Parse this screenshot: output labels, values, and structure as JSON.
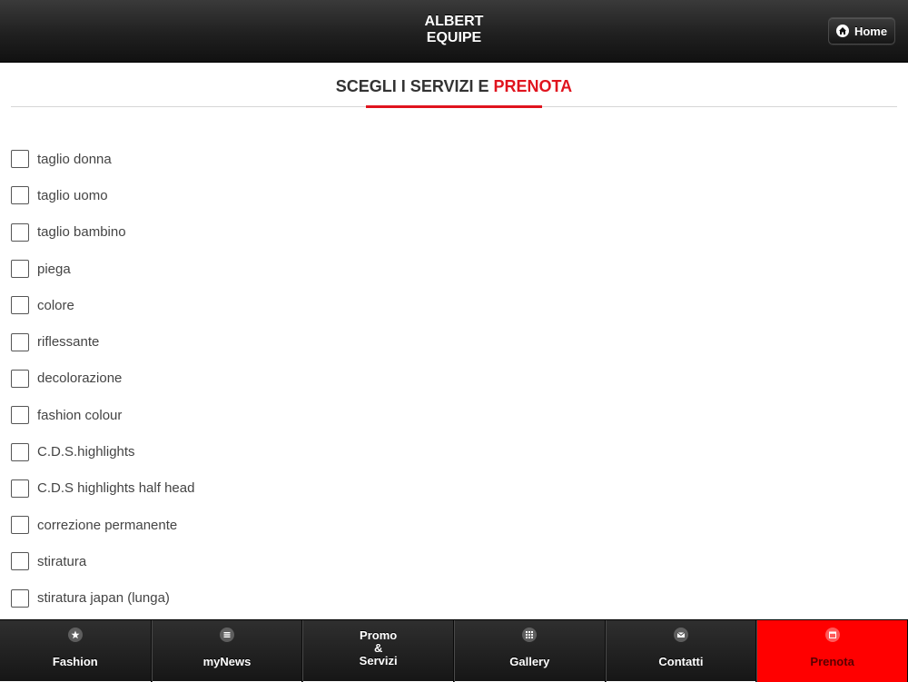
{
  "header": {
    "title_line1": "ALBERT",
    "title_line2": "EQUIPE",
    "home_label": "Home"
  },
  "section": {
    "title_main": "SCEGLI I SERVIZI E ",
    "title_accent": "PRENOTA"
  },
  "services": [
    {
      "label": "taglio donna",
      "checked": false
    },
    {
      "label": "taglio uomo",
      "checked": false
    },
    {
      "label": "taglio bambino",
      "checked": false
    },
    {
      "label": "piega",
      "checked": false
    },
    {
      "label": "colore",
      "checked": false
    },
    {
      "label": "riflessante",
      "checked": false
    },
    {
      "label": "decolorazione",
      "checked": false
    },
    {
      "label": "fashion colour",
      "checked": false
    },
    {
      "label": "C.D.S.highlights",
      "checked": false
    },
    {
      "label": "C.D.S highlights half head",
      "checked": false
    },
    {
      "label": "correzione permanente",
      "checked": false
    },
    {
      "label": "stiratura",
      "checked": false
    },
    {
      "label": "stiratura japan (lunga)",
      "checked": false
    }
  ],
  "tabbar": {
    "tabs": [
      {
        "label": "Fashion",
        "icon": "star-icon",
        "active": false
      },
      {
        "label": "myNews",
        "icon": "menu-icon",
        "active": false
      },
      {
        "label": "Promo\n&\nServizi",
        "icon": "",
        "active": false
      },
      {
        "label": "Gallery",
        "icon": "grid-icon",
        "active": false
      },
      {
        "label": "Contatti",
        "icon": "envelope-icon",
        "active": false
      },
      {
        "label": "Prenota",
        "icon": "calendar-icon",
        "active": true
      }
    ]
  },
  "colors": {
    "accent": "#e0141e",
    "active_tab": "#ff0000",
    "header_dark": "#111111"
  }
}
